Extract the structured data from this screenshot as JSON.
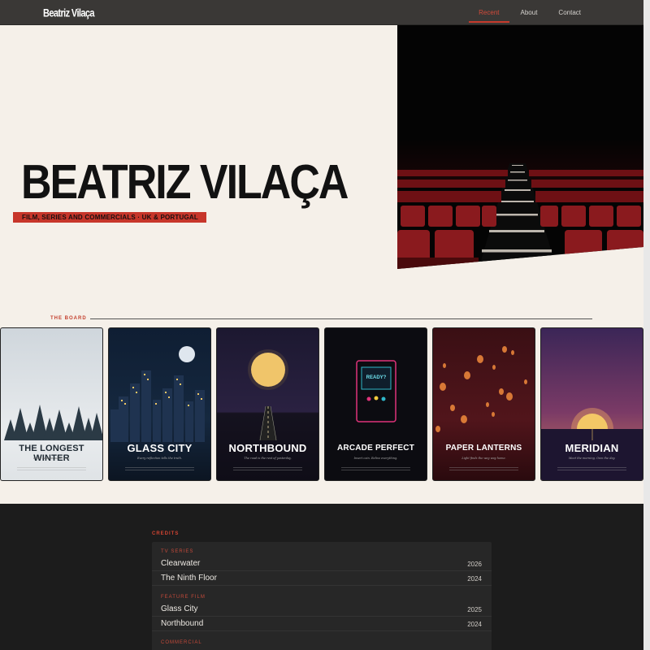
{
  "header": {
    "brand": "Beatriz Vilaça",
    "nav": [
      {
        "label": "Recent",
        "active": true
      },
      {
        "label": "About",
        "active": false
      },
      {
        "label": "Contact",
        "active": false
      }
    ]
  },
  "hero": {
    "name": "BEATRIZ VILAÇA",
    "tagline": "FILM, SERIES AND COMMERCIALS · UK & PORTUGAL"
  },
  "board": {
    "label": "THE BOARD",
    "posters": [
      {
        "title": "THE LONGEST WINTER",
        "subtitle": "Some seasons never end.",
        "theme": "winter"
      },
      {
        "title": "GLASS CITY",
        "subtitle": "Every reflection tells the truth.",
        "theme": "city"
      },
      {
        "title": "NORTHBOUND",
        "subtitle": "The road is the rest of yesterday.",
        "theme": "north"
      },
      {
        "title": "ARCADE PERFECT",
        "subtitle": "Insert coin. Relive everything.",
        "theme": "arcade",
        "screen_text": "READY?"
      },
      {
        "title": "PAPER LANTERNS",
        "subtitle": "Light finds the way way home.",
        "theme": "lanterns"
      },
      {
        "title": "MERIDIAN",
        "subtitle": "Meet the morning. Own the day.",
        "theme": "meridian"
      }
    ]
  },
  "credits": {
    "label": "CREDITS",
    "groups": [
      {
        "category": "TV SERIES",
        "items": [
          {
            "title": "Clearwater",
            "year": "2026"
          },
          {
            "title": "The Ninth Floor",
            "year": "2024"
          }
        ]
      },
      {
        "category": "FEATURE FILM",
        "items": [
          {
            "title": "Glass City",
            "year": "2025"
          },
          {
            "title": "Northbound",
            "year": "2024"
          }
        ]
      },
      {
        "category": "COMMERCIAL",
        "items": []
      }
    ]
  },
  "colors": {
    "accent": "#c7362a",
    "dark": "#1c1c1c",
    "cream": "#f5f0e9"
  }
}
